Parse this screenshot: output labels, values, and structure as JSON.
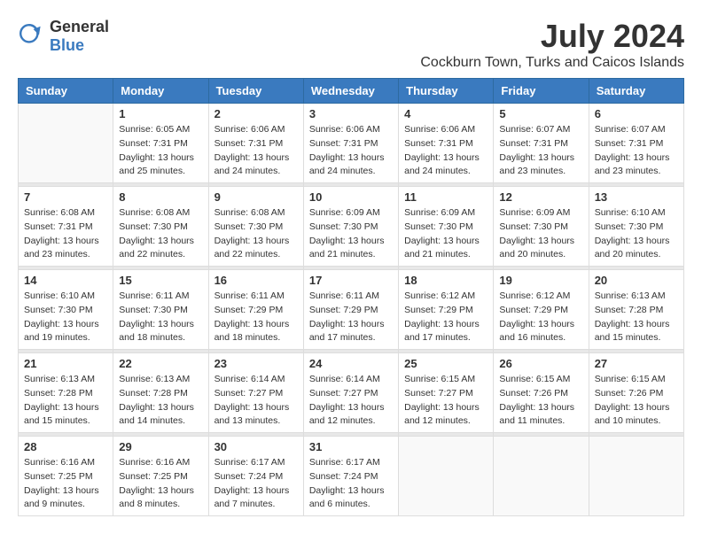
{
  "logo": {
    "text_general": "General",
    "text_blue": "Blue"
  },
  "title": {
    "month_year": "July 2024",
    "location": "Cockburn Town, Turks and Caicos Islands"
  },
  "days_of_week": [
    "Sunday",
    "Monday",
    "Tuesday",
    "Wednesday",
    "Thursday",
    "Friday",
    "Saturday"
  ],
  "weeks": [
    {
      "days": [
        {
          "date": "",
          "sunrise": "",
          "sunset": "",
          "daylight": ""
        },
        {
          "date": "1",
          "sunrise": "Sunrise: 6:05 AM",
          "sunset": "Sunset: 7:31 PM",
          "daylight": "Daylight: 13 hours and 25 minutes."
        },
        {
          "date": "2",
          "sunrise": "Sunrise: 6:06 AM",
          "sunset": "Sunset: 7:31 PM",
          "daylight": "Daylight: 13 hours and 24 minutes."
        },
        {
          "date": "3",
          "sunrise": "Sunrise: 6:06 AM",
          "sunset": "Sunset: 7:31 PM",
          "daylight": "Daylight: 13 hours and 24 minutes."
        },
        {
          "date": "4",
          "sunrise": "Sunrise: 6:06 AM",
          "sunset": "Sunset: 7:31 PM",
          "daylight": "Daylight: 13 hours and 24 minutes."
        },
        {
          "date": "5",
          "sunrise": "Sunrise: 6:07 AM",
          "sunset": "Sunset: 7:31 PM",
          "daylight": "Daylight: 13 hours and 23 minutes."
        },
        {
          "date": "6",
          "sunrise": "Sunrise: 6:07 AM",
          "sunset": "Sunset: 7:31 PM",
          "daylight": "Daylight: 13 hours and 23 minutes."
        }
      ]
    },
    {
      "days": [
        {
          "date": "7",
          "sunrise": "Sunrise: 6:08 AM",
          "sunset": "Sunset: 7:31 PM",
          "daylight": "Daylight: 13 hours and 23 minutes."
        },
        {
          "date": "8",
          "sunrise": "Sunrise: 6:08 AM",
          "sunset": "Sunset: 7:30 PM",
          "daylight": "Daylight: 13 hours and 22 minutes."
        },
        {
          "date": "9",
          "sunrise": "Sunrise: 6:08 AM",
          "sunset": "Sunset: 7:30 PM",
          "daylight": "Daylight: 13 hours and 22 minutes."
        },
        {
          "date": "10",
          "sunrise": "Sunrise: 6:09 AM",
          "sunset": "Sunset: 7:30 PM",
          "daylight": "Daylight: 13 hours and 21 minutes."
        },
        {
          "date": "11",
          "sunrise": "Sunrise: 6:09 AM",
          "sunset": "Sunset: 7:30 PM",
          "daylight": "Daylight: 13 hours and 21 minutes."
        },
        {
          "date": "12",
          "sunrise": "Sunrise: 6:09 AM",
          "sunset": "Sunset: 7:30 PM",
          "daylight": "Daylight: 13 hours and 20 minutes."
        },
        {
          "date": "13",
          "sunrise": "Sunrise: 6:10 AM",
          "sunset": "Sunset: 7:30 PM",
          "daylight": "Daylight: 13 hours and 20 minutes."
        }
      ]
    },
    {
      "days": [
        {
          "date": "14",
          "sunrise": "Sunrise: 6:10 AM",
          "sunset": "Sunset: 7:30 PM",
          "daylight": "Daylight: 13 hours and 19 minutes."
        },
        {
          "date": "15",
          "sunrise": "Sunrise: 6:11 AM",
          "sunset": "Sunset: 7:30 PM",
          "daylight": "Daylight: 13 hours and 18 minutes."
        },
        {
          "date": "16",
          "sunrise": "Sunrise: 6:11 AM",
          "sunset": "Sunset: 7:29 PM",
          "daylight": "Daylight: 13 hours and 18 minutes."
        },
        {
          "date": "17",
          "sunrise": "Sunrise: 6:11 AM",
          "sunset": "Sunset: 7:29 PM",
          "daylight": "Daylight: 13 hours and 17 minutes."
        },
        {
          "date": "18",
          "sunrise": "Sunrise: 6:12 AM",
          "sunset": "Sunset: 7:29 PM",
          "daylight": "Daylight: 13 hours and 17 minutes."
        },
        {
          "date": "19",
          "sunrise": "Sunrise: 6:12 AM",
          "sunset": "Sunset: 7:29 PM",
          "daylight": "Daylight: 13 hours and 16 minutes."
        },
        {
          "date": "20",
          "sunrise": "Sunrise: 6:13 AM",
          "sunset": "Sunset: 7:28 PM",
          "daylight": "Daylight: 13 hours and 15 minutes."
        }
      ]
    },
    {
      "days": [
        {
          "date": "21",
          "sunrise": "Sunrise: 6:13 AM",
          "sunset": "Sunset: 7:28 PM",
          "daylight": "Daylight: 13 hours and 15 minutes."
        },
        {
          "date": "22",
          "sunrise": "Sunrise: 6:13 AM",
          "sunset": "Sunset: 7:28 PM",
          "daylight": "Daylight: 13 hours and 14 minutes."
        },
        {
          "date": "23",
          "sunrise": "Sunrise: 6:14 AM",
          "sunset": "Sunset: 7:27 PM",
          "daylight": "Daylight: 13 hours and 13 minutes."
        },
        {
          "date": "24",
          "sunrise": "Sunrise: 6:14 AM",
          "sunset": "Sunset: 7:27 PM",
          "daylight": "Daylight: 13 hours and 12 minutes."
        },
        {
          "date": "25",
          "sunrise": "Sunrise: 6:15 AM",
          "sunset": "Sunset: 7:27 PM",
          "daylight": "Daylight: 13 hours and 12 minutes."
        },
        {
          "date": "26",
          "sunrise": "Sunrise: 6:15 AM",
          "sunset": "Sunset: 7:26 PM",
          "daylight": "Daylight: 13 hours and 11 minutes."
        },
        {
          "date": "27",
          "sunrise": "Sunrise: 6:15 AM",
          "sunset": "Sunset: 7:26 PM",
          "daylight": "Daylight: 13 hours and 10 minutes."
        }
      ]
    },
    {
      "days": [
        {
          "date": "28",
          "sunrise": "Sunrise: 6:16 AM",
          "sunset": "Sunset: 7:25 PM",
          "daylight": "Daylight: 13 hours and 9 minutes."
        },
        {
          "date": "29",
          "sunrise": "Sunrise: 6:16 AM",
          "sunset": "Sunset: 7:25 PM",
          "daylight": "Daylight: 13 hours and 8 minutes."
        },
        {
          "date": "30",
          "sunrise": "Sunrise: 6:17 AM",
          "sunset": "Sunset: 7:24 PM",
          "daylight": "Daylight: 13 hours and 7 minutes."
        },
        {
          "date": "31",
          "sunrise": "Sunrise: 6:17 AM",
          "sunset": "Sunset: 7:24 PM",
          "daylight": "Daylight: 13 hours and 6 minutes."
        },
        {
          "date": "",
          "sunrise": "",
          "sunset": "",
          "daylight": ""
        },
        {
          "date": "",
          "sunrise": "",
          "sunset": "",
          "daylight": ""
        },
        {
          "date": "",
          "sunrise": "",
          "sunset": "",
          "daylight": ""
        }
      ]
    }
  ]
}
